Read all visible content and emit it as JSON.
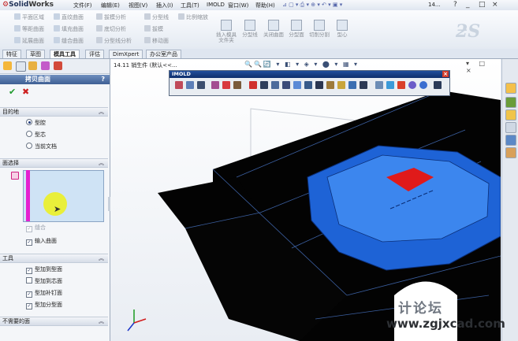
{
  "app": {
    "logo_word": "Solid",
    "logo_word2": "Works"
  },
  "menu": [
    "文件(F)",
    "编辑(E)",
    "视图(V)",
    "插入(I)",
    "工具(T)",
    "IMOLD",
    "窗口(W)",
    "帮助(H)"
  ],
  "window_title": "14...",
  "window_controls": [
    "?",
    "_",
    "□",
    "×"
  ],
  "commands_small": [
    [
      "平面区域",
      "直纹曲面",
      "拔模分析",
      "分型线",
      "比例缩放"
    ],
    [
      "等距曲面",
      "填充曲面",
      "底切分析",
      "拔模"
    ],
    [
      "延展曲面",
      "缝合曲面",
      "分型线分析",
      "移动面"
    ]
  ],
  "commands_large": [
    "插入模具文件夹",
    "分型线",
    "关闭曲面",
    "分型面",
    "切削分割",
    "型心"
  ],
  "tabs": [
    "特征",
    "草图",
    "模具工具",
    "评估",
    "DimXpert",
    "办公室产品"
  ],
  "active_tab_index": 2,
  "breadcrumb": "14.11 销生件  (默认<<...",
  "view_toolbar": "🔍🔍🔄 ▾ ◧ ▾ ◈ ▾ ⬤ ▾ ▦ ▾",
  "viewport_controls": "▾ □ ×",
  "property_manager": {
    "title": "拷贝曲面",
    "help": "?",
    "ok": "✔",
    "cancel": "✖",
    "sections": {
      "target": {
        "label": "目的地",
        "options": [
          "型腔",
          "型芯",
          "当前文档"
        ],
        "selected": 0
      },
      "faces": {
        "label": "面选择",
        "options": [
          {
            "label": "缝合",
            "checked": true,
            "disabled": true
          },
          {
            "label": "输入曲面",
            "checked": true,
            "disabled": false
          }
        ]
      },
      "tools": {
        "label": "工具",
        "options": [
          {
            "label": "型加到型面",
            "checked": true
          },
          {
            "label": "型加到芯面",
            "checked": false
          },
          {
            "label": "型加补钉面",
            "checked": true
          },
          {
            "label": "型加分型面",
            "checked": true
          }
        ]
      },
      "unneeded": {
        "label": "不需要的面"
      }
    }
  },
  "imold_toolbar": {
    "title": "IMOLD",
    "close": "×"
  },
  "watermark": {
    "line1": "计论坛",
    "line2": "www.zgjxcad.com"
  },
  "colors": {
    "accent_blue": "#2d64c8",
    "part_blue": "#1e63d6",
    "red_face": "#e01a1a",
    "parting_black": "#030303",
    "highlight_magenta": "#e51fcf"
  }
}
